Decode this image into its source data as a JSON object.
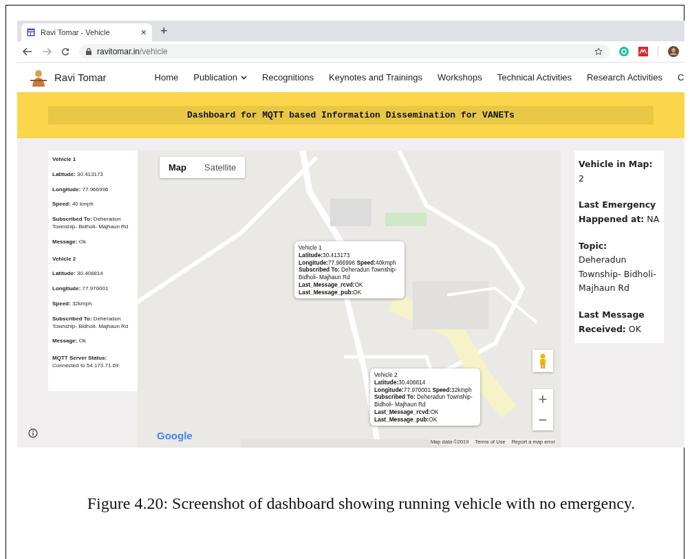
{
  "browser": {
    "tab": {
      "title": "Ravi Tomar - Vehicle",
      "close": "×",
      "selected": true
    },
    "new_tab": "+",
    "url": {
      "host": "ravitomar.in",
      "path": "/vehicle"
    }
  },
  "site": {
    "name": "Ravi Tomar",
    "nav": [
      {
        "label": "Home",
        "has_menu": false
      },
      {
        "label": "Publication",
        "has_menu": true
      },
      {
        "label": "Recognitions",
        "has_menu": false
      },
      {
        "label": "Keynotes and Trainings",
        "has_menu": false
      },
      {
        "label": "Workshops",
        "has_menu": false
      },
      {
        "label": "Technical Activities",
        "has_menu": false
      },
      {
        "label": "Research Activities",
        "has_menu": false
      },
      {
        "label": "C",
        "has_menu": false
      }
    ]
  },
  "banner": "Dashboard for MQTT based Information Dissemination for VANETs",
  "left_panel": {
    "vehicles": [
      {
        "title": "Vehicle 1",
        "fields": [
          {
            "label": "Latitude:",
            "value": "30.413173"
          },
          {
            "label": "Longitude:",
            "value": "77.966996"
          },
          {
            "label": "Speed:",
            "value": "40 kmph"
          },
          {
            "label": "Subscribed To:",
            "value": "Deheradun Township- Bidholi- Majhaun Rd"
          },
          {
            "label": "Message:",
            "value": "Ok"
          }
        ]
      },
      {
        "title": "Vehicle 2",
        "fields": [
          {
            "label": "Latitude:",
            "value": "30.408814"
          },
          {
            "label": "Longitude:",
            "value": "77.970001"
          },
          {
            "label": "Speed:",
            "value": "32kmph"
          },
          {
            "label": "Subscribed To:",
            "value": "Deheradun Township- Bidholi- Majhaun Rd"
          },
          {
            "label": "Message:",
            "value": "Ok"
          }
        ]
      }
    ],
    "server_status": {
      "label": "MQTT Server Status:",
      "value": "Connected to 54.173.71.69"
    }
  },
  "map": {
    "kind": "picture",
    "types": [
      {
        "label": "Map",
        "selected": true
      },
      {
        "label": "Satellite",
        "selected": false
      }
    ],
    "info_windows": [
      {
        "lines": [
          "Vehicle 1",
          "**Latitude:**30.413173",
          "**Longitude:**77.966996 **Speed:**40kmph",
          "**Subscribed To:** Deheradun Township- Bidholi- Majhaun Rd",
          "**Last_Message_rcvd:**OK",
          "**Last_Message_pub:**OK"
        ]
      },
      {
        "lines": [
          "Vehicle 2",
          "**Latitude:**30.408814",
          "**Longitude:**77.970001 **Speed:**32kmph",
          "**Subscribed To:** Deheradun Township- Bidholi- Majhaun Rd",
          "**Last_Message_rcvd:**OK",
          "**Last_Message_pub:**OK"
        ]
      }
    ],
    "zoom_in": "+",
    "zoom_out": "−",
    "logo": "Google",
    "footer": [
      "Map data ©2019",
      "Terms of Use",
      "Report a map error"
    ]
  },
  "right_panel": [
    {
      "label": "Vehicle in Map:",
      "value": "2",
      "block": true
    },
    {
      "label": "Last Emergency Happened at:",
      "value": "NA",
      "block": false
    },
    {
      "label": "Topic:",
      "value": "Deheradun Township- Bidholi- Majhaun Rd",
      "block": true
    },
    {
      "label": "Last Message Received:",
      "value": "OK",
      "block": false
    }
  ],
  "caption": "Figure 4.20: Screenshot of dashboard showing running vehicle with no emergency."
}
